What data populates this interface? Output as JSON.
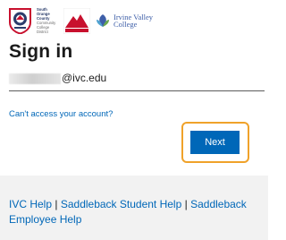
{
  "logos": {
    "south_orange_county": {
      "lines": [
        "South",
        "Orange",
        "County",
        "Community",
        "College District"
      ]
    },
    "irvine_valley": {
      "line1": "Irvine Valley",
      "line2": "College"
    }
  },
  "page": {
    "title": "Sign in"
  },
  "email": {
    "visible_domain": "@ivc.edu"
  },
  "links": {
    "cant_access": "Can't access your account?"
  },
  "buttons": {
    "next": "Next"
  },
  "footer": {
    "ivc_help": "IVC Help",
    "separator": "|",
    "saddleback_student_help": "Saddleback Student Help",
    "saddleback_employee_help": "Saddleback Employee Help"
  },
  "colors": {
    "accent": "#0067b8",
    "highlight": "#f0a22a",
    "saddleback_red": "#c8102e",
    "socccd_navy": "#2b3d6b",
    "footer_bg": "#f2f2f2"
  }
}
